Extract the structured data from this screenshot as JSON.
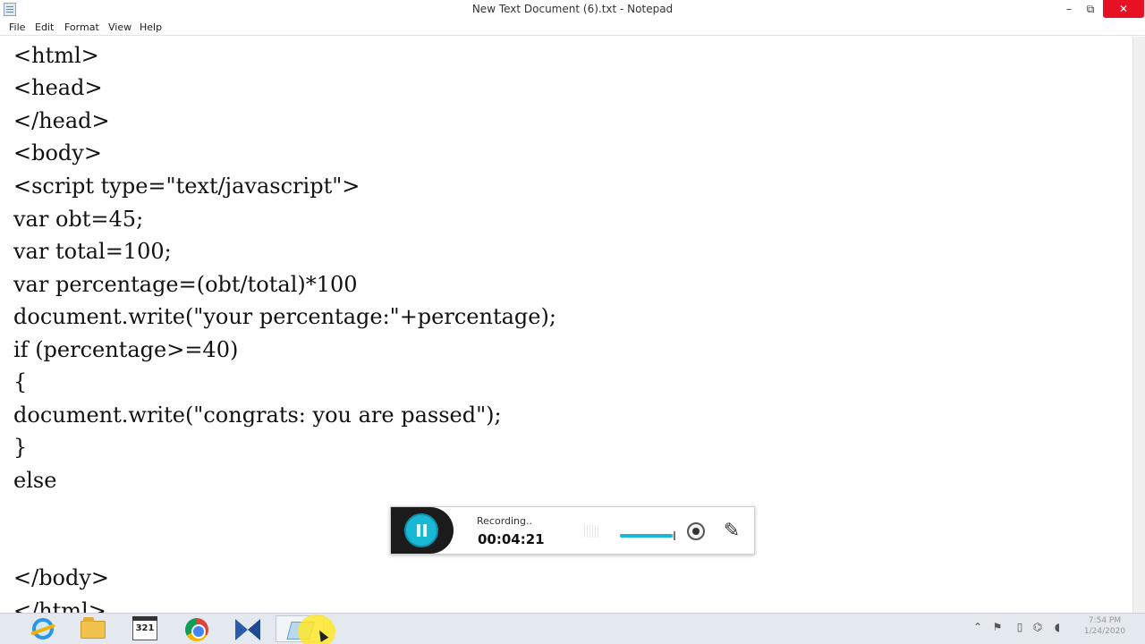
{
  "window": {
    "title": "New Text Document (6).txt - Notepad",
    "controls": {
      "minimize": "–",
      "maximize": "⧉",
      "close": "✕"
    }
  },
  "menu": [
    "File",
    "Edit",
    "Format",
    "View",
    "Help"
  ],
  "editor": {
    "lines": [
      "<html>",
      "<head>",
      "</head>",
      "<body>",
      "<script type=\"text/javascript\">",
      "var obt=45;",
      "var total=100;",
      "var percentage=(obt/total)*100",
      "document.write(\"your percentage:\"+percentage);",
      "if (percentage>=40)",
      "{",
      "document.write(\"congrats: you are passed\");",
      "}",
      "else",
      "",
      "",
      "</body>",
      "</html>"
    ]
  },
  "recorder": {
    "status": "Recording..",
    "elapsed": "00:04:21",
    "volume_level": 0.95,
    "accent_color": "#19b8d6"
  },
  "taskbar": {
    "apps": [
      {
        "name": "internet-explorer-icon"
      },
      {
        "name": "file-explorer-icon"
      },
      {
        "name": "calendar-icon",
        "label": "321"
      },
      {
        "name": "chrome-icon"
      },
      {
        "name": "visual-studio-icon"
      },
      {
        "name": "notepad-icon",
        "active": true
      }
    ],
    "tray_icons": [
      "chevron-up-icon",
      "flag-icon",
      "battery-icon",
      "network-icon",
      "volume-icon"
    ],
    "clock_time": "7:54 PM",
    "clock_date": "1/24/2020"
  }
}
